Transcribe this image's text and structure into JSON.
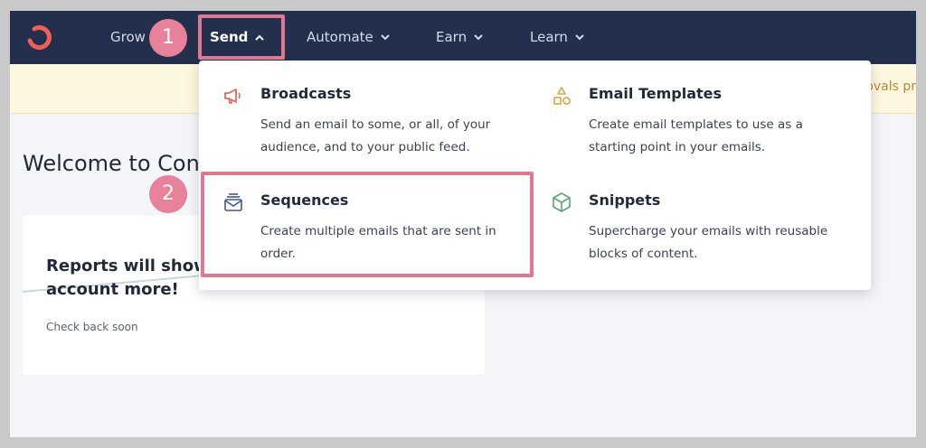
{
  "nav": {
    "items": [
      {
        "label": "Grow"
      },
      {
        "label": "Send"
      },
      {
        "label": "Automate"
      },
      {
        "label": "Earn"
      },
      {
        "label": "Learn"
      }
    ]
  },
  "banner": {
    "text": "ovals pr"
  },
  "welcome": {
    "title": "Welcome to Con"
  },
  "report_card": {
    "title": "Reports will show use your account more!",
    "subtitle": "Check back soon"
  },
  "send_menu": {
    "items": [
      {
        "title": "Broadcasts",
        "description": "Send an email to some, or all, of your audience, and to your public feed.",
        "icon": "megaphone-icon"
      },
      {
        "title": "Email Templates",
        "description": "Create email templates to use as a starting point in your emails.",
        "icon": "shapes-icon"
      },
      {
        "title": "Sequences",
        "description": "Create multiple emails that are sent in order.",
        "icon": "inbox-stack-icon"
      },
      {
        "title": "Snippets",
        "description": "Supercharge your emails with reusable blocks of content.",
        "icon": "cube-icon"
      }
    ]
  },
  "annotations": {
    "step1": "1",
    "step2": "2"
  },
  "colors": {
    "nav_bg": "#222f4d",
    "brand": "#f25e53",
    "highlight": "#e07890",
    "badge": "#e8819a"
  }
}
